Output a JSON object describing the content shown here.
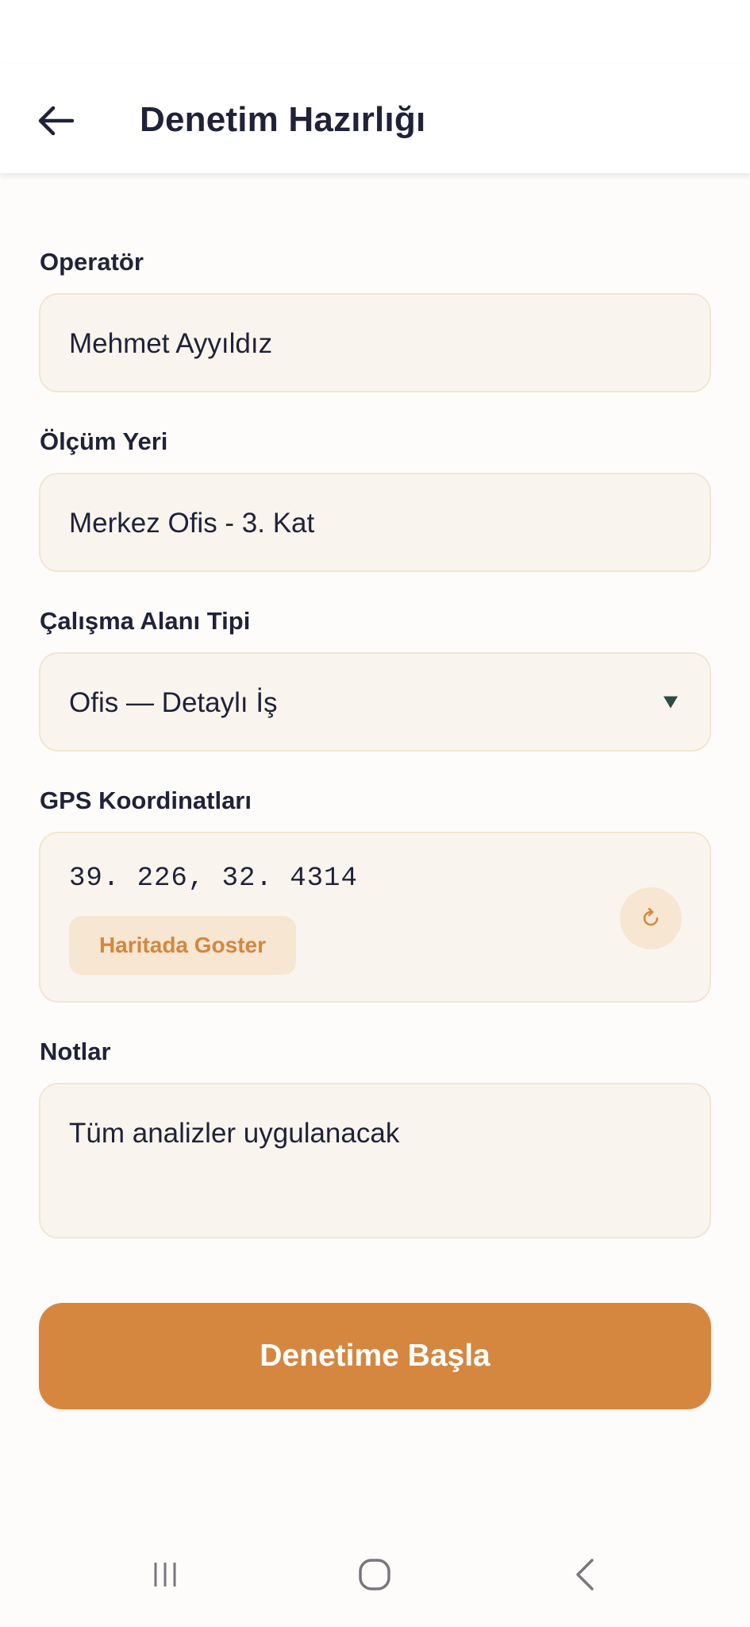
{
  "header": {
    "title": "Denetim Hazırlığı",
    "back_icon": "arrow-left-icon"
  },
  "form": {
    "operator": {
      "label": "Operatör",
      "value": "Mehmet Ayyıldız"
    },
    "location": {
      "label": "Ölçüm Yeri",
      "value": "Merkez Ofis - 3. Kat"
    },
    "workspace_type": {
      "label": "Çalışma Alanı Tipi",
      "value": "Ofis — Detaylı İş"
    },
    "gps": {
      "label": "GPS Koordinatları",
      "value": "39.   226, 32.  4314",
      "map_button": "Haritada Goster",
      "refresh_icon": "refresh-icon"
    },
    "notes": {
      "label": "Notlar",
      "value": "Tüm analizler uygulanacak"
    }
  },
  "actions": {
    "start_label": "Denetime Başla"
  },
  "colors": {
    "accent": "#d58740",
    "field_bg": "#f9f5ee",
    "field_border": "#f2e6d2",
    "text": "#1f2238"
  },
  "nav": {
    "recents_icon": "recents-icon",
    "home_icon": "home-icon",
    "back_icon": "back-chevron-icon"
  }
}
